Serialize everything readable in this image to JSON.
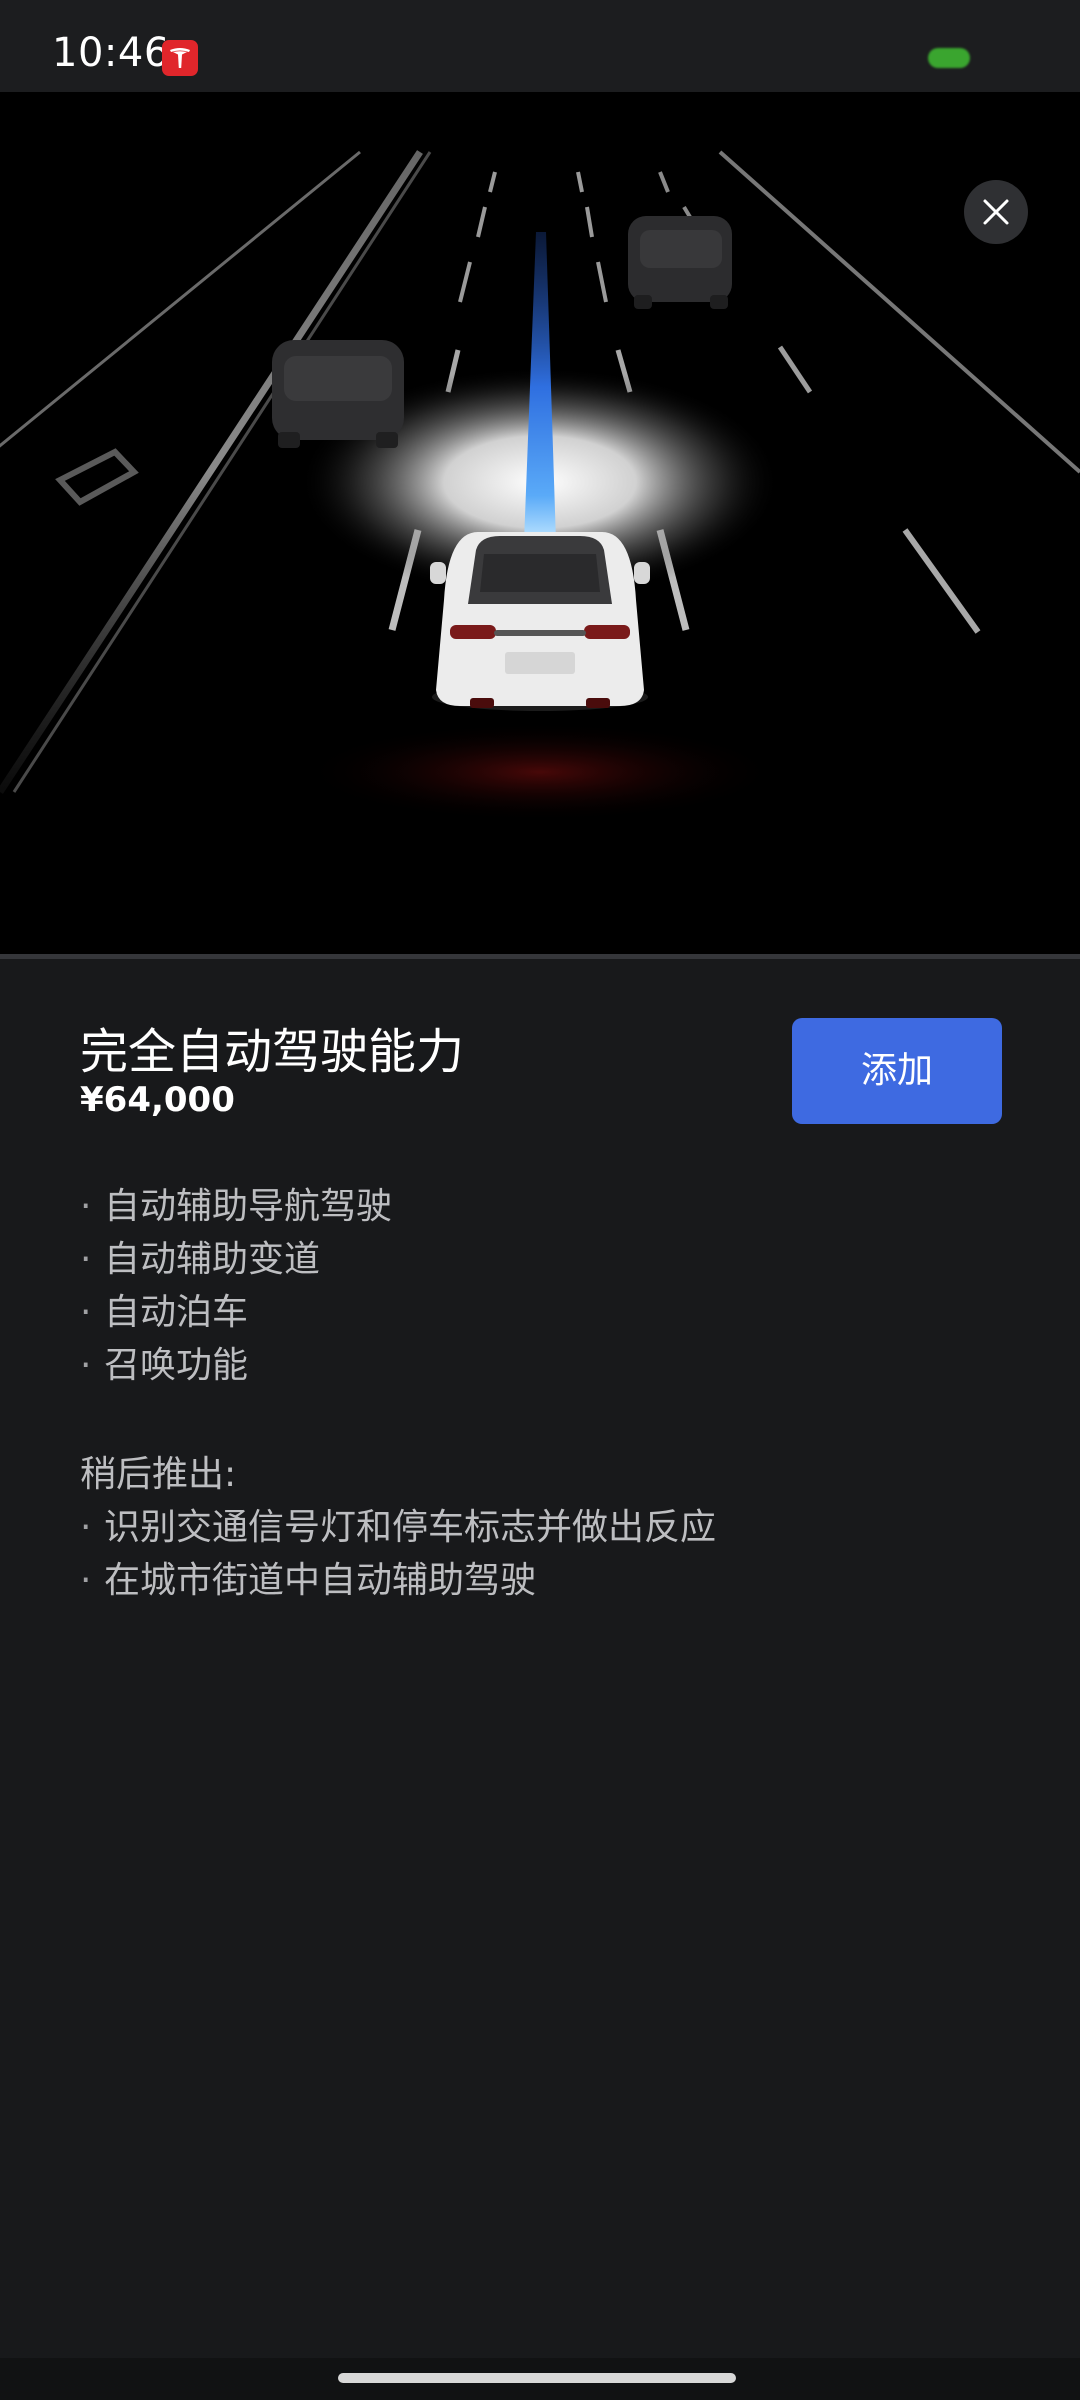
{
  "status_bar": {
    "time": "10:46",
    "app_icon": "tesla-logo-icon",
    "indicator_color": "#3aa52f"
  },
  "hero": {
    "close_icon": "close-icon",
    "accent_lane_color": "#3b7cf0"
  },
  "product": {
    "title": "完全自动驾驶能力",
    "price": "¥64,000",
    "add_label": "添加",
    "button_color": "#3e6ae1"
  },
  "features": {
    "bullet": "·",
    "items": [
      "自动辅助导航驾驶",
      "自动辅助变道",
      "自动泊车",
      "召唤功能"
    ]
  },
  "coming_later": {
    "heading": "稍后推出:",
    "items": [
      "识别交通信号灯和停车标志并做出反应",
      "在城市街道中自动辅助驾驶"
    ]
  }
}
